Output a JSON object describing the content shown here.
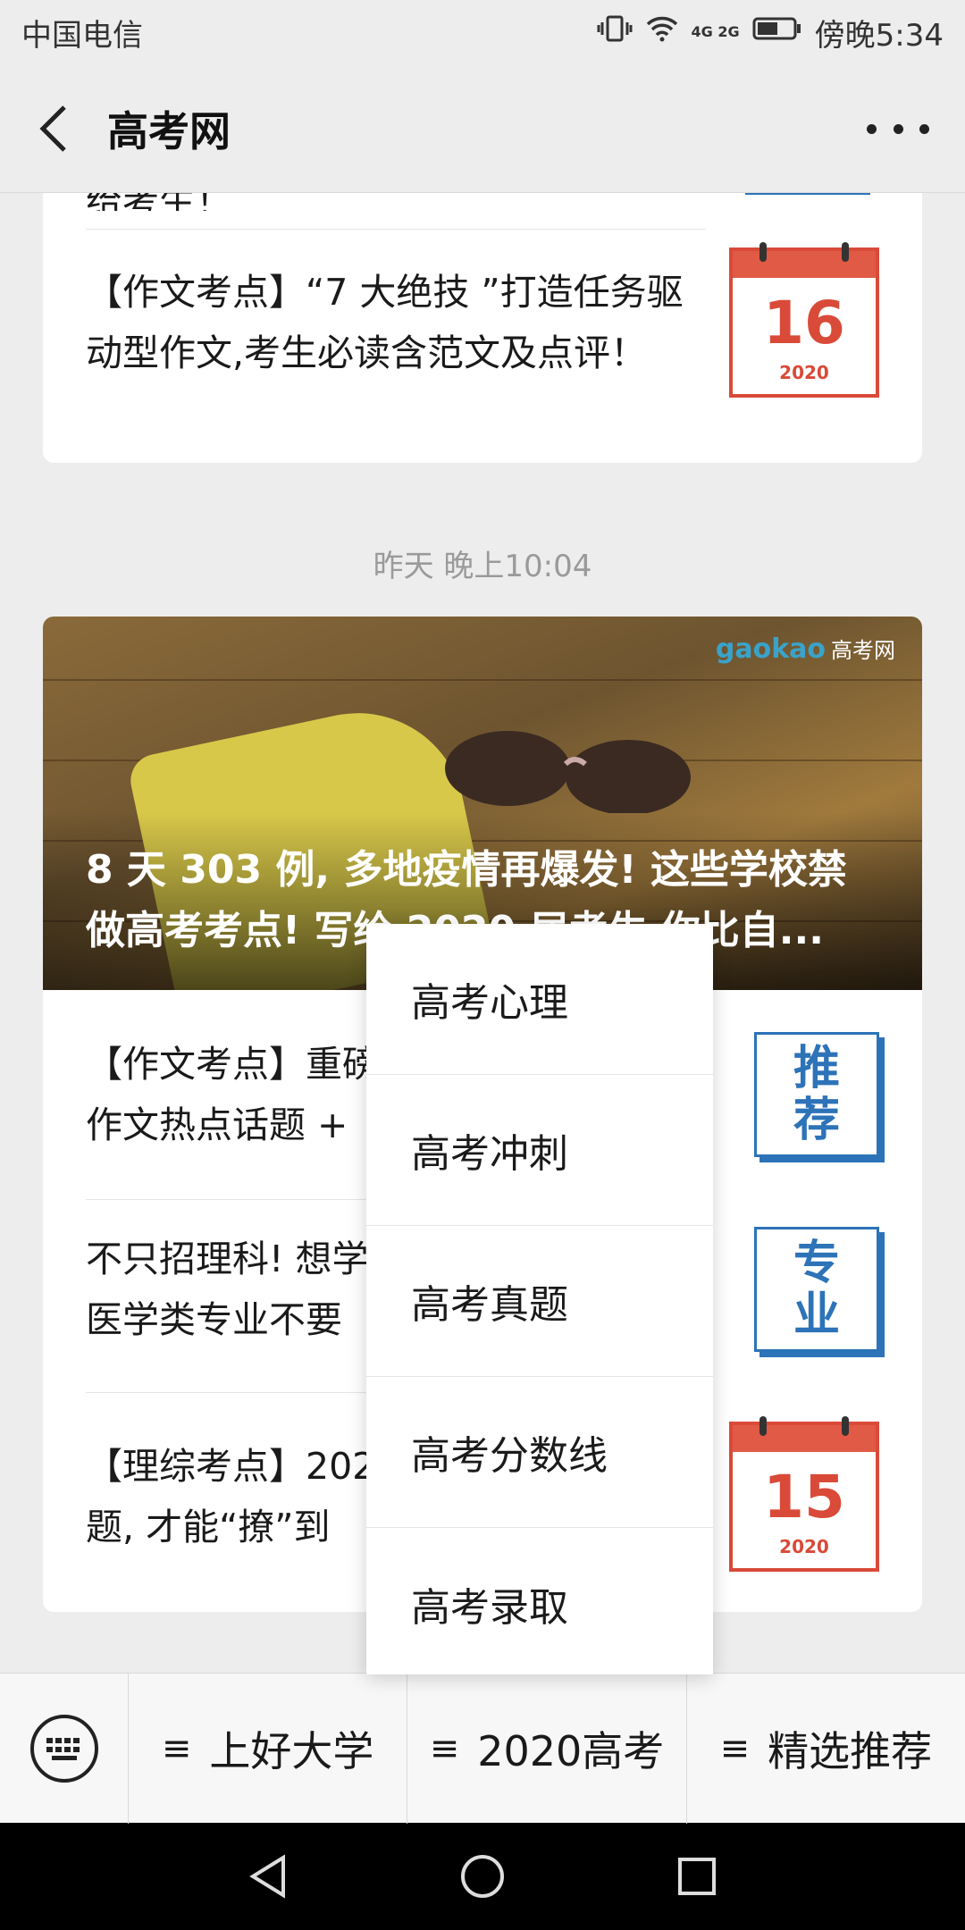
{
  "status_bar": {
    "carrier": "中国电信",
    "network": "4G 2G",
    "time": "傍晚5:34"
  },
  "header": {
    "title": "高考网"
  },
  "articles_top": {
    "partial_text": "给考生！",
    "item": {
      "text": "【作文考点】“7 大绝技 ”打造任务驱动型作文,考生必读含范文及点评！",
      "calendar_day": "16",
      "calendar_year": "2020"
    }
  },
  "timestamp": "昨天 晚上10:04",
  "hero": {
    "logo": "gaokao",
    "logo_sub": "高考网",
    "title_line1": "8 天 303 例, 多地疫情再爆发! 这些学校禁",
    "title_line2": "做高考考点! 写给 2020 届考生 你比自..."
  },
  "articles": [
    {
      "line1": "【作文考点】重磅",
      "line2": "作文热点话题 +",
      "tag": [
        "推",
        "荐"
      ]
    },
    {
      "line1": "不只招理科! 想学",
      "line2": "医学类专业不要",
      "tag": [
        "专",
        "业"
      ]
    },
    {
      "line1": "【理综考点】202",
      "line2": "题, 才能“撩”到",
      "calendar_day": "15",
      "calendar_year": "2020"
    }
  ],
  "popup_menu": [
    "高考心理",
    "高考冲刺",
    "高考真题",
    "高考分数线",
    "高考录取"
  ],
  "bottom_menu": [
    "上好大学",
    "2020高考",
    "精选推荐"
  ],
  "colors": {
    "calendar_red": "#d94a38",
    "tag_blue": "#2d73b8",
    "logo_blue": "#3aa3c9"
  }
}
